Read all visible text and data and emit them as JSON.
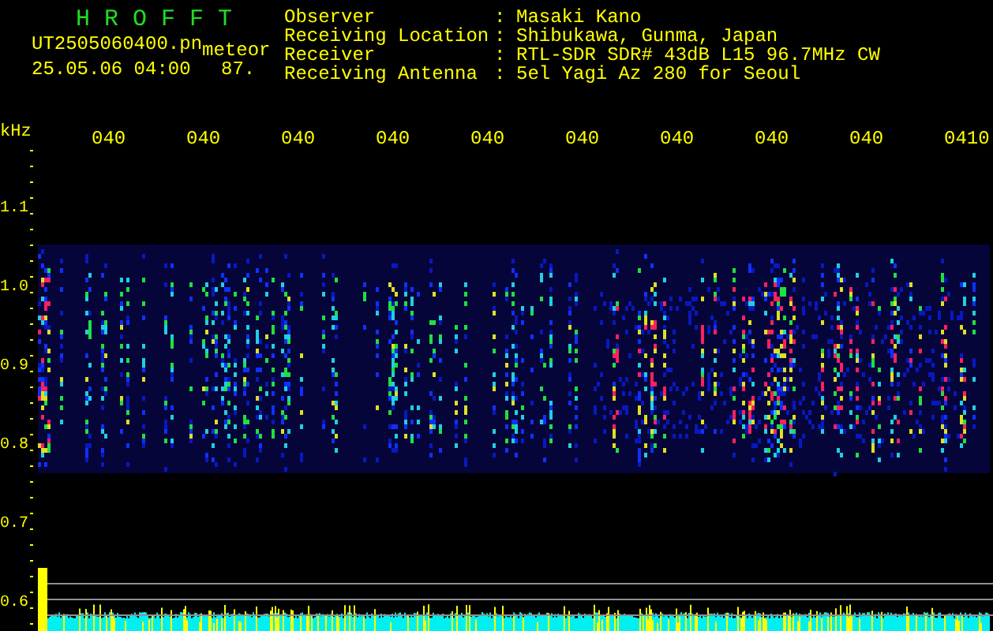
{
  "header": {
    "title": "H R O F F T",
    "file_name": "UT2505060400.pn",
    "category": "meteor",
    "timestamp": "25.05.06 04:00",
    "count": "87."
  },
  "station_info": [
    {
      "label": "Observer",
      "separator": ":",
      "value": "Masaki Kano"
    },
    {
      "label": "Receiving Location",
      "separator": ":",
      "value": "Shibukawa, Gunma, Japan"
    },
    {
      "label": "Receiver",
      "separator": ":",
      "value": "RTL-SDR SDR# 43dB L15 96.7MHz CW"
    },
    {
      "label": "Receiving Antenna",
      "separator": ":",
      "value": "5el Yagi Az 280 for Seoul"
    }
  ],
  "y_axis": {
    "unit": "kHz",
    "labels": [
      "1.1",
      "1.0",
      "0.9",
      "0.8",
      "0.7",
      "0.6"
    ]
  },
  "time_labels": [
    "040",
    "040",
    "040",
    "040",
    "040",
    "040",
    "040",
    "040",
    "040",
    "0410"
  ]
}
